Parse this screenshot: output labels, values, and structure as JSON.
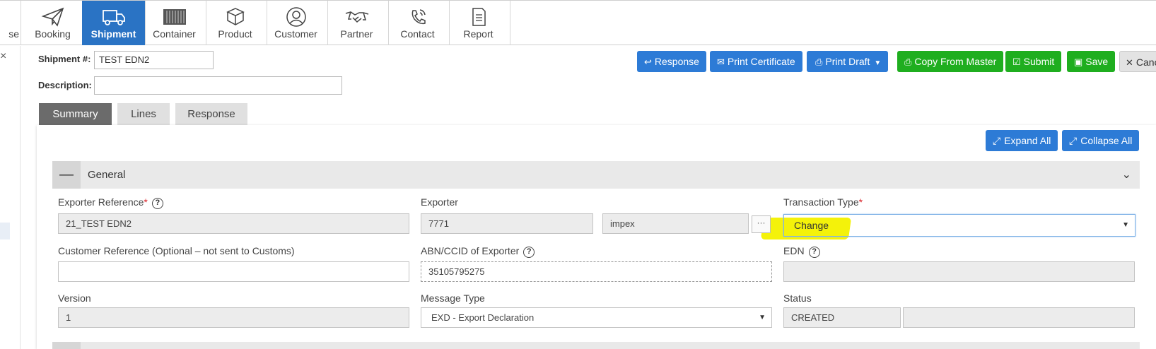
{
  "nav": {
    "partial_label": "se",
    "items": [
      {
        "label": "Booking",
        "icon": "paper-plane-icon"
      },
      {
        "label": "Shipment",
        "icon": "truck-icon",
        "active": true
      },
      {
        "label": "Container",
        "icon": "container-icon"
      },
      {
        "label": "Product",
        "icon": "box-icon"
      },
      {
        "label": "Customer",
        "icon": "user-icon"
      },
      {
        "label": "Partner",
        "icon": "handshake-icon"
      },
      {
        "label": "Contact",
        "icon": "phone-icon"
      },
      {
        "label": "Report",
        "icon": "document-icon"
      }
    ],
    "active_color": "#2a73c4"
  },
  "left": {
    "close_glyph": "×"
  },
  "header": {
    "shipment_label": "Shipment #:",
    "shipment_value": "TEST EDN2",
    "description_label": "Description:",
    "description_value": ""
  },
  "toolbar": {
    "response": "Response",
    "print_certificate": "Print Certificate",
    "print_draft": "Print Draft",
    "copy_from_master": "Copy From Master",
    "submit": "Submit",
    "save": "Save",
    "cancel": "Canc"
  },
  "tabs": [
    {
      "label": "Summary",
      "active": true
    },
    {
      "label": "Lines"
    },
    {
      "label": "Response"
    }
  ],
  "panel": {
    "expand_all": "Expand All",
    "collapse_all": "Collapse All",
    "section_title": "General"
  },
  "fields": {
    "exporter_reference": {
      "label": "Exporter Reference",
      "required": "*",
      "value": "21_TEST EDN2"
    },
    "exporter": {
      "label": "Exporter",
      "code": "7771",
      "name": "impex",
      "ellipsis": "···"
    },
    "transaction_type": {
      "label": "Transaction Type",
      "required": "*",
      "value": "Change"
    },
    "customer_reference": {
      "label": "Customer Reference (Optional – not sent to Customs)",
      "value": ""
    },
    "abn_ccid": {
      "label": "ABN/CCID of Exporter",
      "value": "35105795275"
    },
    "edn": {
      "label": "EDN",
      "value": ""
    },
    "version": {
      "label": "Version",
      "value": "1"
    },
    "message_type": {
      "label": "Message Type",
      "value": "EXD - Export Declaration"
    },
    "status": {
      "label": "Status",
      "value": "CREATED",
      "value2": ""
    }
  },
  "colors": {
    "primary": "#2d7bd6",
    "success": "#1fae1f",
    "highlight": "#f4f20a"
  }
}
